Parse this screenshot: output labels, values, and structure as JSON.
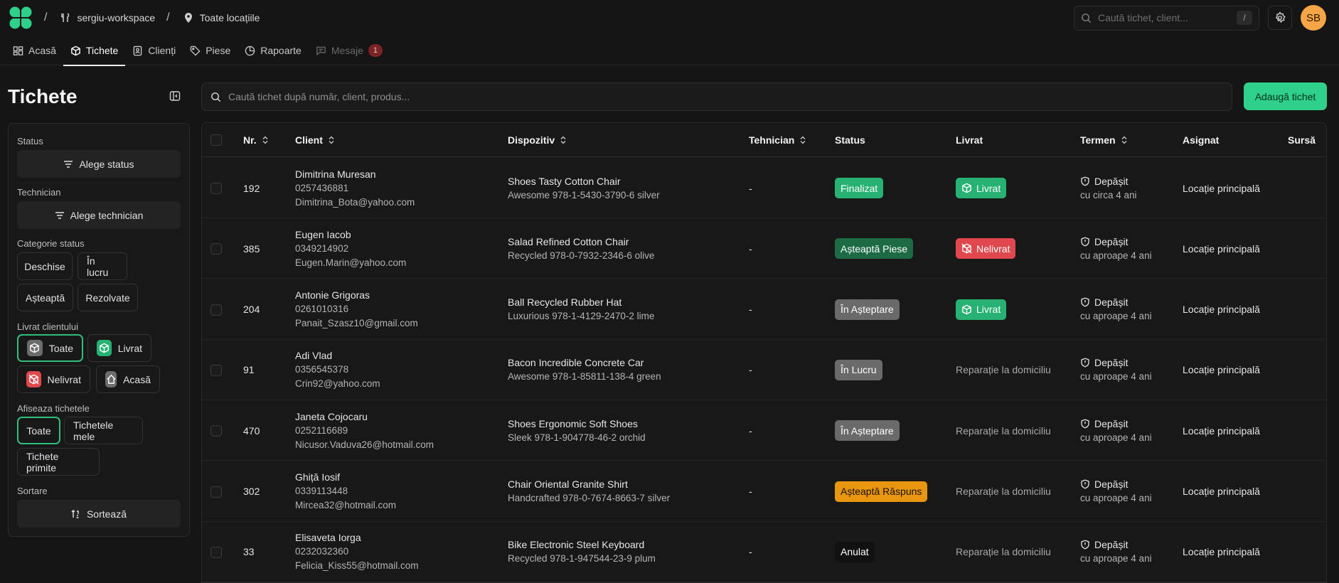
{
  "workspace": "sergiu-workspace",
  "location_crumb": "Toate locațiile",
  "global_search": {
    "placeholder": "Caută tichet, client...",
    "shortcut": "/"
  },
  "user": {
    "initials": "SB"
  },
  "tabs": [
    {
      "label": "Acasă",
      "icon": "dashboard-icon",
      "active": false
    },
    {
      "label": "Tichete",
      "icon": "box-icon",
      "active": true
    },
    {
      "label": "Clienți",
      "icon": "contacts-icon",
      "active": false
    },
    {
      "label": "Piese",
      "icon": "tag-icon",
      "active": false
    },
    {
      "label": "Rapoarte",
      "icon": "chart-pie-icon",
      "active": false
    },
    {
      "label": "Mesaje",
      "icon": "message-icon",
      "active": false,
      "badge": "1"
    }
  ],
  "sidebar": {
    "title": "Tichete",
    "status_label": "Status",
    "status_button": "Alege status",
    "technician_label": "Technician",
    "technician_button": "Alege technician",
    "category_label": "Categorie status",
    "categories": [
      "Deschise",
      "În lucru",
      "Așteaptă",
      "Rezolvate"
    ],
    "delivered_label": "Livrat clientului",
    "delivered_options": [
      "Toate",
      "Livrat",
      "Nelivrat",
      "Acasă"
    ],
    "show_label": "Afiseaza tichetele",
    "show_options": [
      "Toate",
      "Tichetele mele",
      "Tichete primite"
    ],
    "sort_label": "Sortare",
    "sort_button": "Sortează"
  },
  "main_search": {
    "placeholder": "Caută tichet după număr, client, produs..."
  },
  "add_button": "Adaugă tichet",
  "columns": [
    "Nr.",
    "Client",
    "Dispozitiv",
    "Tehnician",
    "Status",
    "Livrat",
    "Termen",
    "Asignat",
    "Sursă"
  ],
  "colors": {
    "accent": "#2fd18a",
    "status_finalizat": "#27b173",
    "status_piese": "#1c6b45",
    "status_grey": "#6a6a6a",
    "status_raspuns": "#e8950f",
    "status_anulat": "#111111",
    "livrat": "#27b173",
    "nelivrat": "#e0484e"
  },
  "rows": [
    {
      "nr": "192",
      "client_name": "Dimitrina Muresan",
      "client_phone": "0257436881",
      "client_email": "Dimitrina_Bota@yahoo.com",
      "device_name": "Shoes Tasty Cotton Chair",
      "device_detail": "Awesome 978-1-5430-3790-6 silver",
      "technician": "-",
      "status": "Finalizat",
      "status_color": "#27b173",
      "delivered": "Livrat",
      "delivered_kind": "livrat",
      "deadline": "Depășit",
      "deadline_sub": "cu circa 4 ani",
      "assigned": "Locație principală"
    },
    {
      "nr": "385",
      "client_name": "Eugen Iacob",
      "client_phone": "0349214902",
      "client_email": "Eugen.Marin@yahoo.com",
      "device_name": "Salad Refined Cotton Chair",
      "device_detail": "Recycled 978-0-7932-2346-6 olive",
      "technician": "-",
      "status": "Așteaptă Piese",
      "status_color": "#1c6b45",
      "delivered": "Nelivrat",
      "delivered_kind": "nelivrat",
      "deadline": "Depășit",
      "deadline_sub": "cu aproape 4 ani",
      "assigned": "Locație principală"
    },
    {
      "nr": "204",
      "client_name": "Antonie Grigoras",
      "client_phone": "0261010316",
      "client_email": "Panait_Szasz10@gmail.com",
      "device_name": "Ball Recycled Rubber Hat",
      "device_detail": "Luxurious 978-1-4129-2470-2 lime",
      "technician": "-",
      "status": "În Așteptare",
      "status_color": "#6a6a6a",
      "delivered": "Livrat",
      "delivered_kind": "livrat",
      "deadline": "Depășit",
      "deadline_sub": "cu aproape 4 ani",
      "assigned": "Locație principală"
    },
    {
      "nr": "91",
      "client_name": "Adi Vlad",
      "client_phone": "0356545378",
      "client_email": "Crin92@yahoo.com",
      "device_name": "Bacon Incredible Concrete Car",
      "device_detail": "Awesome 978-1-85811-138-4 green",
      "technician": "-",
      "status": "În Lucru",
      "status_color": "#6a6a6a",
      "delivered": "Reparație la domiciliu",
      "delivered_kind": "text",
      "deadline": "Depășit",
      "deadline_sub": "cu aproape 4 ani",
      "assigned": "Locație principală"
    },
    {
      "nr": "470",
      "client_name": "Janeta Cojocaru",
      "client_phone": "0252116689",
      "client_email": "Nicusor.Vaduva26@hotmail.com",
      "device_name": "Shoes Ergonomic Soft Shoes",
      "device_detail": "Sleek 978-1-904778-46-2 orchid",
      "technician": "-",
      "status": "În Așteptare",
      "status_color": "#6a6a6a",
      "delivered": "Reparație la domiciliu",
      "delivered_kind": "text",
      "deadline": "Depășit",
      "deadline_sub": "cu aproape 4 ani",
      "assigned": "Locație principală"
    },
    {
      "nr": "302",
      "client_name": "Ghiță Iosif",
      "client_phone": "0339113448",
      "client_email": "Mircea32@hotmail.com",
      "device_name": "Chair Oriental Granite Shirt",
      "device_detail": "Handcrafted 978-0-7674-8663-7 silver",
      "technician": "-",
      "status": "Așteaptă Răspuns",
      "status_color": "#e8950f",
      "delivered": "Reparație la domiciliu",
      "delivered_kind": "text",
      "deadline": "Depășit",
      "deadline_sub": "cu aproape 4 ani",
      "assigned": "Locație principală"
    },
    {
      "nr": "33",
      "client_name": "Elisaveta Iorga",
      "client_phone": "0232032360",
      "client_email": "Felicia_Kiss55@hotmail.com",
      "device_name": "Bike Electronic Steel Keyboard",
      "device_detail": "Recycled 978-1-947544-23-9 plum",
      "technician": "-",
      "status": "Anulat",
      "status_color": "#111111",
      "delivered": "Reparație la domiciliu",
      "delivered_kind": "text",
      "deadline": "Depășit",
      "deadline_sub": "cu aproape 4 ani",
      "assigned": "Locație principală"
    }
  ]
}
